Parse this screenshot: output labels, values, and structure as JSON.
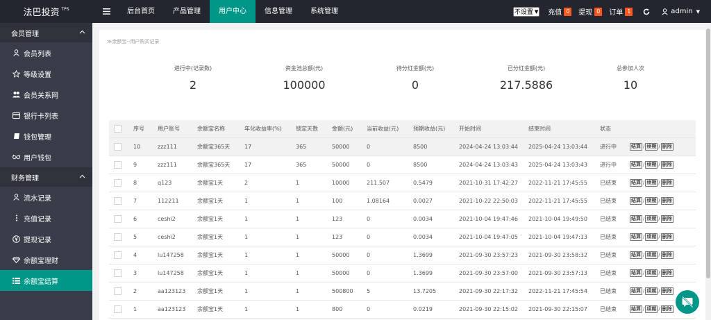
{
  "header": {
    "logo": "法巴投资",
    "logo_sup": "TPS",
    "nav": [
      {
        "label": "后台首页",
        "active": false
      },
      {
        "label": "产品管理",
        "active": false
      },
      {
        "label": "用户中心",
        "active": true
      },
      {
        "label": "信息管理",
        "active": false
      },
      {
        "label": "系统管理",
        "active": false
      }
    ],
    "select_value": "不设置",
    "recharge_label": "充值",
    "recharge_count": "0",
    "withdraw_label": "提现",
    "withdraw_count": "0",
    "order_label": "订单",
    "order_count": "1",
    "user": "admin"
  },
  "sidebar": {
    "group1": "会员管理",
    "group1_items": [
      {
        "label": "会员列表",
        "icon": "user-icon"
      },
      {
        "label": "等级设置",
        "icon": "star-icon"
      },
      {
        "label": "会员关系网",
        "icon": "users-icon"
      },
      {
        "label": "银行卡列表",
        "icon": "card-icon"
      },
      {
        "label": "钱包管理",
        "icon": "wallet-icon"
      },
      {
        "label": "用户钱包",
        "icon": "glasses-icon"
      }
    ],
    "group2": "财务管理",
    "group2_items": [
      {
        "label": "流水记录",
        "icon": "user-icon"
      },
      {
        "label": "充值记录",
        "icon": "dots-icon"
      },
      {
        "label": "提现记录",
        "icon": "yen-icon"
      },
      {
        "label": "余额宝理财",
        "icon": "diamond-icon"
      },
      {
        "label": "余额宝结算",
        "icon": "list-icon",
        "active": true
      }
    ]
  },
  "breadcrumb": "≫余额宝--用户购买记录",
  "stats": [
    {
      "label": "进行中(记录数)",
      "value": "2"
    },
    {
      "label": "资金池总额(元)",
      "value": "100000"
    },
    {
      "label": "待分红金额(元)",
      "value": "0"
    },
    {
      "label": "已分红金额(元)",
      "value": "217.5886"
    },
    {
      "label": "总参加人次",
      "value": "10"
    }
  ],
  "table": {
    "headers": [
      "序号",
      "用户账号",
      "余额宝名称",
      "年化收益率(%)",
      "锁定天数",
      "金额(元)",
      "当前收益(元)",
      "预期收益(元)",
      "开始时间",
      "结束时间",
      "状态"
    ],
    "actions": [
      "结算",
      "续期",
      "删除"
    ],
    "rows": [
      [
        "10",
        "zzz111",
        "余额宝365天",
        "17",
        "365",
        "50000",
        "0",
        "8500",
        "2024-04-24 13:03:44",
        "2025-04-24 13:03:44",
        "进行中"
      ],
      [
        "9",
        "zzz111",
        "余额宝365天",
        "17",
        "365",
        "50000",
        "0",
        "8500",
        "2024-04-24 13:03:43",
        "2025-04-24 13:03:43",
        "进行中"
      ],
      [
        "8",
        "q123",
        "余额宝1天",
        "2",
        "1",
        "10000",
        "211.507",
        "0.5479",
        "2021-10-31 17:42:27",
        "2022-11-21 17:45:55",
        "已结束"
      ],
      [
        "7",
        "112211",
        "余额宝1天",
        "1",
        "1",
        "100",
        "1.08164",
        "0.0027",
        "2021-10-22 22:50:03",
        "2022-11-21 17:45:55",
        "已结束"
      ],
      [
        "6",
        "ceshi2",
        "余额宝1天",
        "1",
        "1",
        "123",
        "0",
        "0.0034",
        "2021-10-04 19:47:46",
        "2021-10-04 19:49:50",
        "已结束"
      ],
      [
        "5",
        "ceshi2",
        "余额宝1天",
        "1",
        "1",
        "123",
        "0",
        "0.0034",
        "2021-10-04 19:47:05",
        "2021-10-04 19:47:13",
        "已结束"
      ],
      [
        "4",
        "lu147258",
        "余额宝1天",
        "1",
        "1",
        "50000",
        "0",
        "1.3699",
        "2021-09-30 23:57:23",
        "2021-09-30 23:58:32",
        "已结束"
      ],
      [
        "3",
        "lu147258",
        "余额宝1天",
        "1",
        "1",
        "50000",
        "0",
        "1.3699",
        "2021-09-30 23:57:00",
        "2021-09-30 23:57:13",
        "已结束"
      ],
      [
        "2",
        "aa123123",
        "余额宝1天",
        "1",
        "1",
        "500800",
        "5",
        "13.7205",
        "2021-09-30 22:17:32",
        "2022-11-21 17:45:54",
        "已结束"
      ],
      [
        "1",
        "aa123123",
        "余额宝1天",
        "1",
        "1",
        "800",
        "0",
        "0.0219",
        "2021-09-30 22:15:02",
        "2021-09-30 22:15:07",
        "已结束"
      ]
    ]
  },
  "colors": {
    "accent": "#009688",
    "sidebar": "#393d49",
    "topbar": "#23262e",
    "badge": "#ff5722"
  }
}
